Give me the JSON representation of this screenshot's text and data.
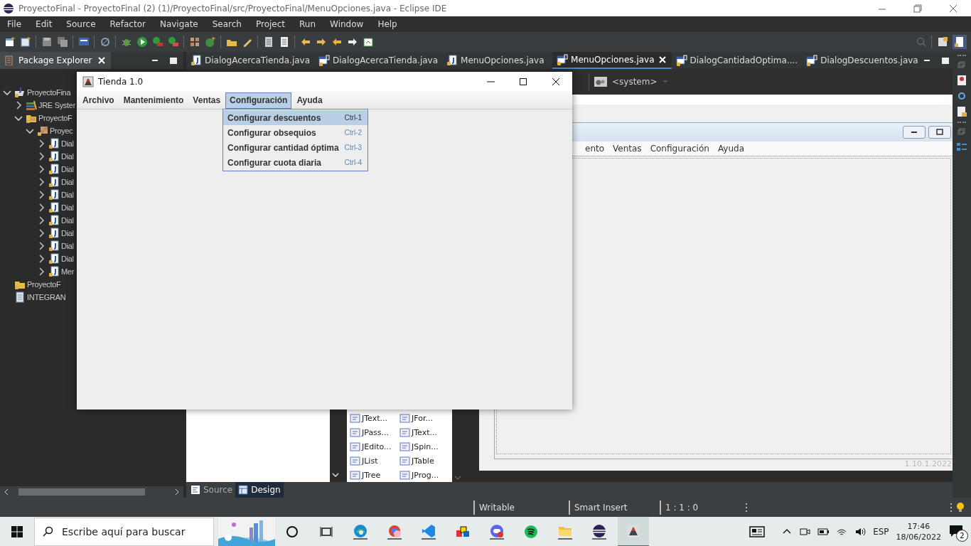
{
  "window": {
    "title": "ProyectoFinal - ProyectoFinal (2) (1)/ProyectoFinal/src/ProyectoFinal/MenuOpciones.java - Eclipse IDE"
  },
  "menu_bar": [
    "File",
    "Edit",
    "Source",
    "Refactor",
    "Navigate",
    "Search",
    "Project",
    "Run",
    "Window",
    "Help"
  ],
  "package_explorer": {
    "title": "Package Explorer",
    "tree": [
      {
        "label": "ProyectoFina",
        "kind": "project",
        "expanded": true,
        "children": [
          {
            "label": "JRE Syster",
            "kind": "library",
            "expanded": false
          },
          {
            "label": "ProyectoF",
            "kind": "source",
            "expanded": true,
            "children": [
              {
                "label": "Proyec",
                "kind": "package",
                "expanded": true,
                "children": [
                  {
                    "label": "Dial",
                    "kind": "java",
                    "expanded": false
                  },
                  {
                    "label": "Dial",
                    "kind": "java",
                    "expanded": false
                  },
                  {
                    "label": "Dial",
                    "kind": "java",
                    "expanded": false
                  },
                  {
                    "label": "Dial",
                    "kind": "java",
                    "expanded": false
                  },
                  {
                    "label": "Dial",
                    "kind": "java",
                    "expanded": false
                  },
                  {
                    "label": "Dial",
                    "kind": "java",
                    "expanded": false
                  },
                  {
                    "label": "Dial",
                    "kind": "java",
                    "expanded": false
                  },
                  {
                    "label": "Dial",
                    "kind": "java",
                    "expanded": false
                  },
                  {
                    "label": "Dial",
                    "kind": "java",
                    "expanded": false
                  },
                  {
                    "label": "Dial",
                    "kind": "java",
                    "expanded": false
                  },
                  {
                    "label": "Mer",
                    "kind": "java",
                    "expanded": false
                  }
                ]
              }
            ]
          }
        ]
      },
      {
        "label": "ProyectoF",
        "kind": "folder"
      },
      {
        "label": "INTEGRAN",
        "kind": "file"
      }
    ]
  },
  "editor_tabs": [
    {
      "label": "DialogAcercaTienda.java",
      "kind": "java",
      "selected": false
    },
    {
      "label": "DialogAcercaTienda.java",
      "kind": "form",
      "selected": false
    },
    {
      "label": "MenuOpciones.java",
      "kind": "java",
      "selected": false
    },
    {
      "label": "MenuOpciones.java",
      "kind": "form",
      "selected": true
    },
    {
      "label": "DialogCantidadOptima....",
      "kind": "form",
      "selected": false
    },
    {
      "label": "DialogDescuentos.java",
      "kind": "form",
      "selected": false
    }
  ],
  "editor_toolbar": {
    "look_and_feel": "<system>"
  },
  "design_preview": {
    "menu": [
      "ento",
      "Ventas",
      "Configuración",
      "Ayuda"
    ],
    "version": "1.10.1.2022"
  },
  "palette": [
    "JText...",
    "JFor...",
    "JPass...",
    "JText...",
    "JEdito...",
    "JSpin...",
    "JList",
    "JTable",
    "JTree",
    "JProg..."
  ],
  "view_tabs": [
    {
      "label": "Source",
      "selected": false
    },
    {
      "label": "Design",
      "selected": true
    }
  ],
  "status_bar": [
    "Writable",
    "Smart Insert",
    "1 : 1 : 0"
  ],
  "app_window": {
    "title": "Tienda 1.0",
    "menus": [
      {
        "label": "Archivo",
        "selected": false
      },
      {
        "label": "Mantenimiento",
        "selected": false
      },
      {
        "label": "Ventas",
        "selected": false
      },
      {
        "label": "Configuración",
        "selected": true
      },
      {
        "label": "Ayuda",
        "selected": false
      }
    ],
    "dropdown": [
      {
        "label": "Configurar descuentos",
        "shortcut": "Ctrl-1",
        "selected": true
      },
      {
        "label": "Configurar obsequios",
        "shortcut": "Ctrl-2",
        "selected": false
      },
      {
        "label": "Configurar cantidad óptima",
        "shortcut": "Ctrl-3",
        "selected": false
      },
      {
        "label": "Configurar cuota diaria",
        "shortcut": "Ctrl-4",
        "selected": false
      }
    ]
  },
  "taskbar": {
    "search_placeholder": "Escribe aquí para buscar",
    "language": "ESP",
    "time": "17:46",
    "date": "18/06/2022",
    "notifications": "2"
  }
}
